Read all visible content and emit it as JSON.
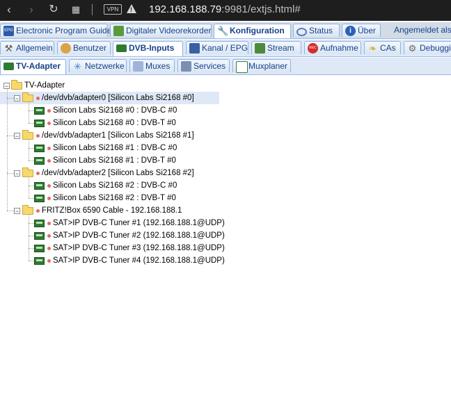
{
  "browser": {
    "url_host": "192.168.188.79",
    "url_rest": ":9981/extjs.html#",
    "vpn_label": "VPN",
    "nav_back_icon": "back-arrow-icon",
    "nav_forward_icon": "forward-arrow-icon",
    "reload_icon": "reload-icon",
    "apps_icon": "grid-icon",
    "warning_icon": "warning-icon"
  },
  "main_tabs": [
    {
      "label": "Electronic Program Guide",
      "icon": "epg-icon"
    },
    {
      "label": "Digitaler Videorekorder",
      "icon": "download-icon"
    },
    {
      "label": "Konfiguration",
      "icon": "wrench-icon",
      "active": true
    },
    {
      "label": "Status",
      "icon": "eye-icon"
    },
    {
      "label": "Über",
      "icon": "info-icon"
    }
  ],
  "logged_in": "Angemeldet als T",
  "config_tabs": [
    {
      "label": "Allgemein",
      "icon": "tools-icon"
    },
    {
      "label": "Benutzer",
      "icon": "users-icon"
    },
    {
      "label": "DVB-Inputs",
      "icon": "dvb-card-icon",
      "active": true
    },
    {
      "label": "Kanal / EPG",
      "icon": "tv-icon"
    },
    {
      "label": "Stream",
      "icon": "stream-icon"
    },
    {
      "label": "Aufnahme",
      "icon": "rec-icon"
    },
    {
      "label": "CAs",
      "icon": "key-icon"
    },
    {
      "label": "Debuggin",
      "icon": "gear-icon"
    }
  ],
  "dvb_tabs": [
    {
      "label": "TV-Adapter",
      "icon": "dvb-card-icon",
      "active": true
    },
    {
      "label": "Netzwerke",
      "icon": "network-icon"
    },
    {
      "label": "Muxes",
      "icon": "muxes-icon"
    },
    {
      "label": "Services",
      "icon": "services-icon"
    },
    {
      "label": "Muxplaner",
      "icon": "calendar-icon"
    }
  ],
  "tree": {
    "root": "TV-Adapter",
    "adapters": [
      {
        "label": "/dev/dvb/adapter0 [Silicon Labs Si2168 #0]",
        "selected": true,
        "tuners": [
          "Silicon Labs Si2168 #0 : DVB-C #0",
          "Silicon Labs Si2168 #0 : DVB-T #0"
        ]
      },
      {
        "label": "/dev/dvb/adapter1 [Silicon Labs Si2168 #1]",
        "tuners": [
          "Silicon Labs Si2168 #1 : DVB-C #0",
          "Silicon Labs Si2168 #1 : DVB-T #0"
        ]
      },
      {
        "label": "/dev/dvb/adapter2 [Silicon Labs Si2168 #2]",
        "tuners": [
          "Silicon Labs Si2168 #2 : DVB-C #0",
          "Silicon Labs Si2168 #2 : DVB-T #0"
        ]
      },
      {
        "label": "FRITZ!Box 6590 Cable - 192.168.188.1",
        "tuners": [
          "SAT>IP DVB-C Tuner #1 (192.168.188.1@UDP)",
          "SAT>IP DVB-C Tuner #2 (192.168.188.1@UDP)",
          "SAT>IP DVB-C Tuner #3 (192.168.188.1@UDP)",
          "SAT>IP DVB-C Tuner #4 (192.168.188.1@UDP)"
        ]
      }
    ]
  },
  "colors": {
    "accent": "#15428b",
    "tab_bg": "#dfe8f6",
    "status_dot": "#e36a6a",
    "folder": "#f6d86b"
  }
}
